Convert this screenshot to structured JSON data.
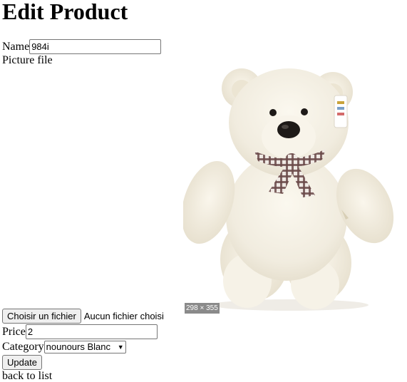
{
  "page": {
    "title": "Edit Product"
  },
  "form": {
    "name_label": "Name",
    "name_value": "984i",
    "picture_label": "Picture file",
    "file_button_label": "Choisir un fichier",
    "file_status": "Aucun fichier choisi",
    "image_size_tag": "298 × 355",
    "price_label": "Price",
    "price_value": "2",
    "category_label": "Category",
    "category_selected": "nounours Blanc",
    "update_label": "Update",
    "trailing_text": "back to list"
  },
  "icons": {
    "select_arrow": "chevron-down-icon"
  }
}
